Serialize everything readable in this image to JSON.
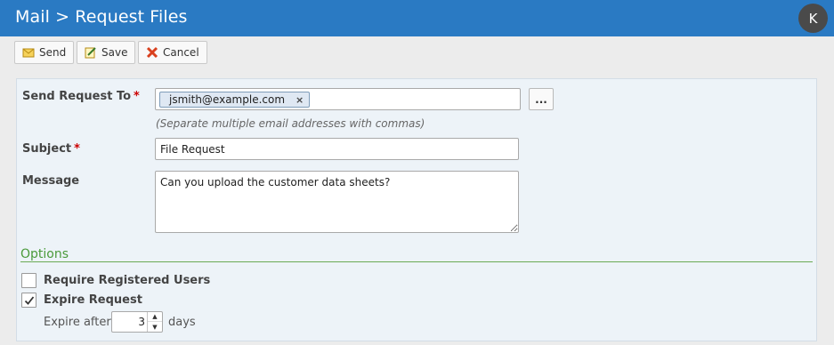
{
  "header": {
    "title": "Mail > Request Files",
    "avatar_initial": "K"
  },
  "toolbar": {
    "send_label": "Send",
    "save_label": "Save",
    "cancel_label": "Cancel"
  },
  "form": {
    "to_label": "Send Request To",
    "required_marker": "*",
    "recipients": [
      "jsmith@example.com"
    ],
    "chip_remove": "×",
    "browse_label": "...",
    "hint": "(Separate multiple email addresses with commas)",
    "subject_label": "Subject",
    "subject_value": "File Request",
    "message_label": "Message",
    "message_value": "Can you upload the customer data sheets?"
  },
  "options": {
    "title": "Options",
    "require_registered_label": "Require Registered Users",
    "require_registered_checked": false,
    "expire_request_label": "Expire Request",
    "expire_request_checked": true,
    "expire_after_label": "Expire after",
    "expire_after_value": "3",
    "days_label": "days"
  },
  "colors": {
    "header_bg": "#2a7ac3",
    "options_accent": "#4a9a3a",
    "required": "#cc0000"
  }
}
